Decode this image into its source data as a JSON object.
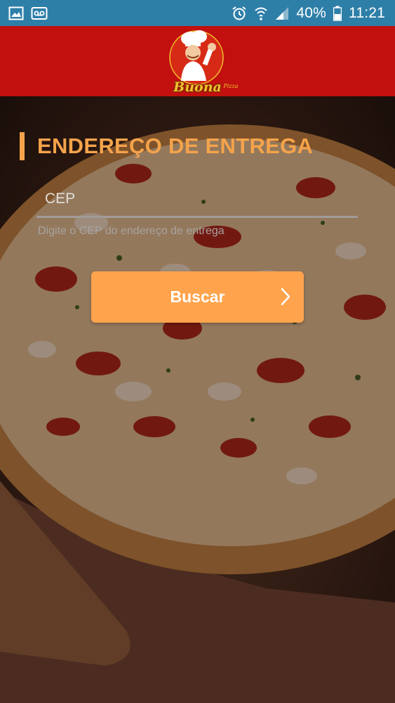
{
  "status_bar": {
    "left_icons": [
      "image-icon",
      "voicemail-icon"
    ],
    "right_icons": [
      "alarm-icon",
      "wifi-icon",
      "signal-icon",
      "battery-icon"
    ],
    "battery_percent": "40%",
    "time": "11:21",
    "background": "#2e7fa8"
  },
  "app_bar": {
    "background": "#c1100e",
    "logo": {
      "brand": "Buona",
      "sub": "Pizza",
      "icon": "chef-logo-icon"
    }
  },
  "form": {
    "title": "ENDEREÇO DE ENTREGA",
    "cep": {
      "value": "",
      "placeholder": "CEP"
    },
    "helper": "Digite o CEP do endereço de entrega",
    "search_button": {
      "label": "Buscar",
      "icon": "chevron-right-icon",
      "color": "#ffa44d"
    },
    "accent": "#f5a34b"
  }
}
